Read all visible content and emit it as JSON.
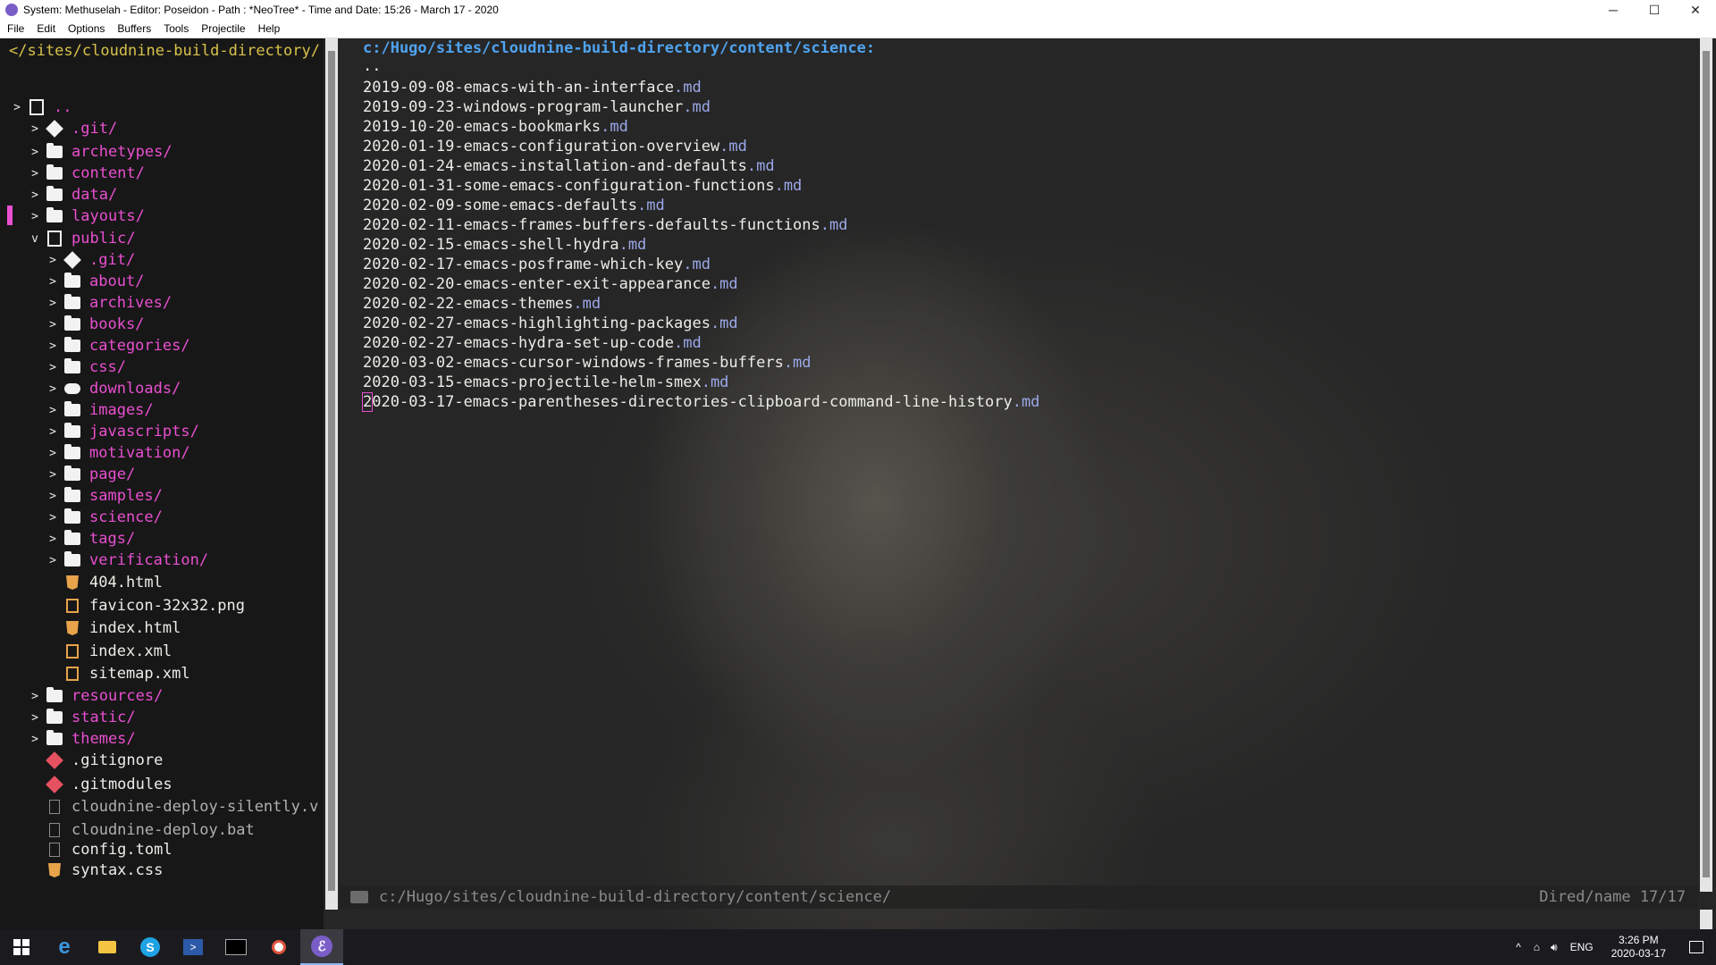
{
  "window": {
    "title": "System: Methuselah - Editor: Poseidon - Path :  *NeoTree* - Time and Date: 15:26 - March 17 - 2020",
    "controls": {
      "minimize": "─",
      "maximize": "☐",
      "close": "✕"
    }
  },
  "menu": [
    "File",
    "Edit",
    "Options",
    "Buffers",
    "Tools",
    "Projectile",
    "Help"
  ],
  "sidebar": {
    "header": "</sites/cloudnine-build-directory/",
    "items": [
      {
        "chev": ">",
        "icon": "repo-icon",
        "label": "..",
        "color": "magenta"
      },
      {
        "chev": ">",
        "icon": "git-icon",
        "label": ".git/",
        "color": "magenta"
      },
      {
        "chev": ">",
        "icon": "folder-icon",
        "label": "archetypes/",
        "color": "magenta"
      },
      {
        "chev": ">",
        "icon": "folder-icon",
        "label": "content/",
        "color": "magenta"
      },
      {
        "chev": ">",
        "icon": "folder-icon",
        "label": "data/",
        "color": "magenta"
      },
      {
        "chev": ">",
        "icon": "folder-icon",
        "label": "layouts/",
        "color": "magenta"
      },
      {
        "chev": "v",
        "icon": "repo-icon",
        "label": "public/",
        "color": "magenta"
      },
      {
        "chev": ">",
        "icon": "git-icon",
        "label": ".git/",
        "color": "magenta"
      },
      {
        "chev": ">",
        "icon": "folder-icon",
        "label": "about/",
        "color": "magenta"
      },
      {
        "chev": ">",
        "icon": "folder-icon",
        "label": "archives/",
        "color": "magenta"
      },
      {
        "chev": ">",
        "icon": "folder-icon",
        "label": "books/",
        "color": "magenta"
      },
      {
        "chev": ">",
        "icon": "folder-icon",
        "label": "categories/",
        "color": "magenta"
      },
      {
        "chev": ">",
        "icon": "folder-icon",
        "label": "css/",
        "color": "magenta"
      },
      {
        "chev": ">",
        "icon": "cloud-download-icon",
        "label": "downloads/",
        "color": "magenta"
      },
      {
        "chev": ">",
        "icon": "folder-icon",
        "label": "images/",
        "color": "magenta"
      },
      {
        "chev": ">",
        "icon": "folder-icon",
        "label": "javascripts/",
        "color": "magenta"
      },
      {
        "chev": ">",
        "icon": "folder-icon",
        "label": "motivation/",
        "color": "magenta"
      },
      {
        "chev": ">",
        "icon": "folder-icon",
        "label": "page/",
        "color": "magenta"
      },
      {
        "chev": ">",
        "icon": "folder-icon",
        "label": "samples/",
        "color": "magenta"
      },
      {
        "chev": ">",
        "icon": "folder-icon",
        "label": "science/",
        "color": "magenta"
      },
      {
        "chev": ">",
        "icon": "folder-icon",
        "label": "tags/",
        "color": "magenta"
      },
      {
        "chev": ">",
        "icon": "folder-icon",
        "label": "verification/",
        "color": "magenta"
      },
      {
        "chev": "",
        "icon": "html5-icon",
        "label": "404.html",
        "color": "white"
      },
      {
        "chev": "",
        "icon": "image-file-icon",
        "label": "favicon-32x32.png",
        "color": "white"
      },
      {
        "chev": "",
        "icon": "html5-icon",
        "label": "index.html",
        "color": "white"
      },
      {
        "chev": "",
        "icon": "xml-file-icon",
        "label": "index.xml",
        "color": "white"
      },
      {
        "chev": "",
        "icon": "xml-file-icon",
        "label": "sitemap.xml",
        "color": "white"
      },
      {
        "chev": ">",
        "icon": "folder-icon",
        "label": "resources/",
        "color": "magenta"
      },
      {
        "chev": ">",
        "icon": "folder-icon",
        "label": "static/",
        "color": "magenta"
      },
      {
        "chev": ">",
        "icon": "folder-icon",
        "label": "themes/",
        "color": "magenta"
      },
      {
        "chev": "",
        "icon": "git-file-icon",
        "label": ".gitignore",
        "color": "white"
      },
      {
        "chev": "",
        "icon": "git-file-icon",
        "label": ".gitmodules",
        "color": "white"
      },
      {
        "chev": "",
        "icon": "file-icon",
        "label": "cloudnine-deploy-silently.v",
        "color": "grey"
      },
      {
        "chev": "",
        "icon": "file-icon",
        "label": "cloudnine-deploy.bat",
        "color": "grey"
      },
      {
        "chev": "",
        "icon": "file-icon",
        "label": "config.toml",
        "color": "white"
      },
      {
        "chev": "",
        "icon": "html5-icon",
        "label": "syntax.css",
        "color": "white"
      }
    ]
  },
  "dired": {
    "path": "c:/Hugo/sites/cloudnine-build-directory/content/science:",
    "parent": "..",
    "current": ".",
    "files": [
      {
        "name": "2019-09-08-emacs-with-an-interface",
        "ext": ".md"
      },
      {
        "name": "2019-09-23-windows-program-launcher",
        "ext": ".md"
      },
      {
        "name": "2019-10-20-emacs-bookmarks",
        "ext": ".md"
      },
      {
        "name": "2020-01-19-emacs-configuration-overview",
        "ext": ".md"
      },
      {
        "name": "2020-01-24-emacs-installation-and-defaults",
        "ext": ".md"
      },
      {
        "name": "2020-01-31-some-emacs-configuration-functions",
        "ext": ".md"
      },
      {
        "name": "2020-02-09-some-emacs-defaults",
        "ext": ".md"
      },
      {
        "name": "2020-02-11-emacs-frames-buffers-defaults-functions",
        "ext": ".md"
      },
      {
        "name": "2020-02-15-emacs-shell-hydra",
        "ext": ".md"
      },
      {
        "name": "2020-02-17-emacs-posframe-which-key",
        "ext": ".md"
      },
      {
        "name": "2020-02-20-emacs-enter-exit-appearance",
        "ext": ".md"
      },
      {
        "name": "2020-02-22-emacs-themes",
        "ext": ".md"
      },
      {
        "name": "2020-02-27-emacs-highlighting-packages",
        "ext": ".md"
      },
      {
        "name": "2020-02-27-emacs-hydra-set-up-code",
        "ext": ".md"
      },
      {
        "name": "2020-03-02-emacs-cursor-windows-frames-buffers",
        "ext": ".md"
      },
      {
        "name": "2020-03-15-emacs-projectile-helm-smex",
        "ext": ".md"
      },
      {
        "name": "2020-03-17-emacs-parentheses-directories-clipboard-command-line-history",
        "ext": ".md"
      }
    ]
  },
  "modeline": {
    "path": "c:/Hugo/sites/cloudnine-build-directory/content/science/",
    "mode": "Dired/name 17/17"
  },
  "taskbar": {
    "apps": [
      "windows-start-icon",
      "edge-icon",
      "file-explorer-icon",
      "skype-icon",
      "powershell-icon",
      "terminal-icon",
      "media-icon",
      "emacs-icon"
    ],
    "language": "ENG",
    "time": "3:26 PM",
    "date": "2020-03-17"
  },
  "colors": {
    "folder_label": "#e94fd0",
    "header": "#d8c14a",
    "path": "#4fa3f0",
    "extension": "#9ba8e8"
  }
}
